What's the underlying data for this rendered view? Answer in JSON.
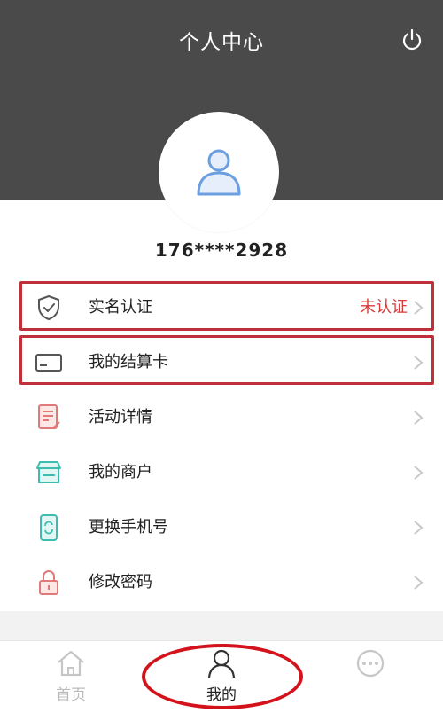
{
  "header": {
    "title": "个人中心",
    "power_icon": "power-icon"
  },
  "profile": {
    "avatar_icon": "user-avatar-icon",
    "phone": "176****2928"
  },
  "menu": [
    {
      "id": "real-name",
      "label": "实名认证",
      "status": "未认证",
      "icon": "shield-check-icon",
      "icon_color": "#555555"
    },
    {
      "id": "settlement-card",
      "label": "我的结算卡",
      "icon": "card-icon",
      "icon_color": "#555555"
    },
    {
      "id": "activity",
      "label": "活动详情",
      "icon": "document-icon",
      "icon_color": "#e07a7a"
    },
    {
      "id": "merchant",
      "label": "我的商户",
      "icon": "store-icon",
      "icon_color": "#3dbdb0"
    },
    {
      "id": "change-phone",
      "label": "更换手机号",
      "icon": "phone-swap-icon",
      "icon_color": "#3dbdb0"
    },
    {
      "id": "password",
      "label": "修改密码",
      "icon": "lock-icon",
      "icon_color": "#e07a7a"
    }
  ],
  "tabs": [
    {
      "id": "home",
      "label": "首页",
      "icon": "home-icon",
      "active": false
    },
    {
      "id": "mine",
      "label": "我的",
      "icon": "person-icon",
      "active": true
    },
    {
      "id": "more",
      "label": "",
      "icon": "more-icon",
      "active": false
    }
  ],
  "colors": {
    "header_bg": "#4a4a4a",
    "accent_red": "#c0303b",
    "status_red": "#d93b3b",
    "avatar_blue": "#6b9fe0"
  }
}
